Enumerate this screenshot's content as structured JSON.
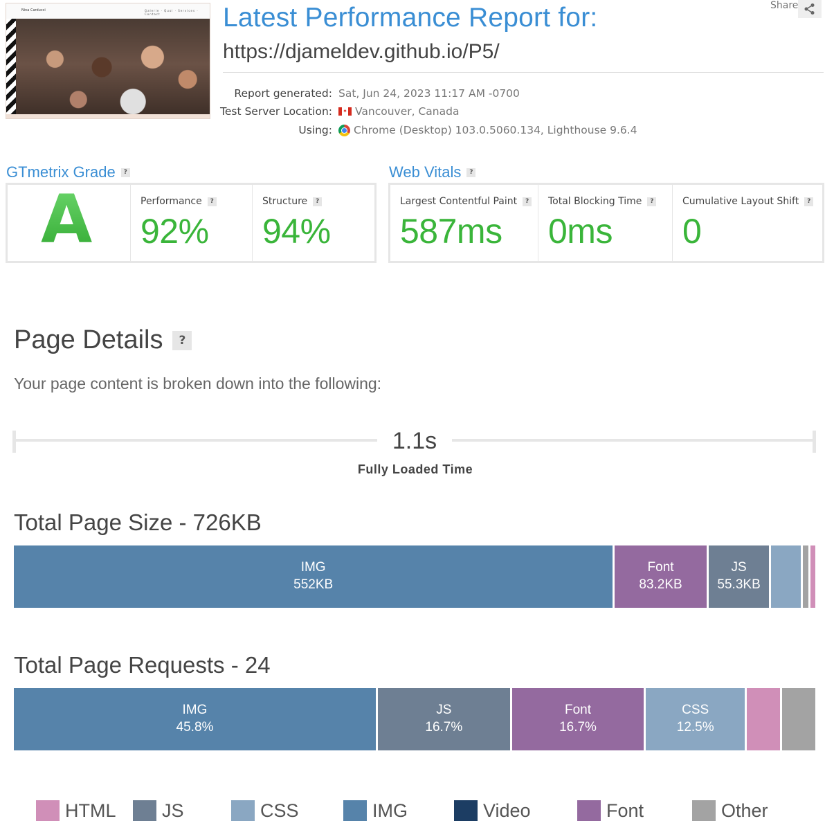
{
  "header": {
    "thumb_brand": "Nina Carducci",
    "thumb_nav": "Galerie · Quoi · Services · Contact",
    "title": "Latest Performance Report for:",
    "url": "https://djameldev.github.io/P5/",
    "share_label": "Share",
    "meta": {
      "report_generated_label": "Report generated:",
      "report_generated_value": "Sat, Jun 24, 2023 11:17 AM -0700",
      "location_label": "Test Server Location:",
      "location_value": "Vancouver, Canada",
      "using_label": "Using:",
      "using_value": "Chrome (Desktop) 103.0.5060.134, Lighthouse 9.6.4"
    }
  },
  "grade": {
    "heading": "GTmetrix Grade",
    "letter": "A",
    "performance_label": "Performance",
    "performance_value": "92%",
    "structure_label": "Structure",
    "structure_value": "94%"
  },
  "vitals": {
    "heading": "Web Vitals",
    "lcp_label": "Largest Contentful Paint",
    "lcp_value": "587ms",
    "tbt_label": "Total Blocking Time",
    "tbt_value": "0ms",
    "cls_label": "Cumulative Layout Shift",
    "cls_value": "0"
  },
  "page_details": {
    "title": "Page Details",
    "subtitle": "Your page content is broken down into the following:",
    "fully_loaded_value": "1.1s",
    "fully_loaded_label": "Fully Loaded Time"
  },
  "qmark": "?",
  "size_bar": {
    "title": "Total Page Size - 726KB",
    "segments": [
      {
        "type": "IMG",
        "value": "552KB",
        "share": 75.1
      },
      {
        "type": "Font",
        "value": "83.2KB",
        "share": 11.5
      },
      {
        "type": "JS",
        "value": "55.3KB",
        "share": 7.6
      },
      {
        "type": "CSS",
        "value": "",
        "share": 3.7
      },
      {
        "type": "Other",
        "value": "",
        "share": 0.7
      },
      {
        "type": "HTML",
        "value": "",
        "share": 0.6
      }
    ]
  },
  "requests_bar": {
    "title": "Total Page Requests - 24",
    "segments": [
      {
        "type": "IMG",
        "value": "45.8%",
        "share": 45.8
      },
      {
        "type": "JS",
        "value": "16.7%",
        "share": 16.7
      },
      {
        "type": "Font",
        "value": "16.7%",
        "share": 16.7
      },
      {
        "type": "CSS",
        "value": "12.5%",
        "share": 12.5
      },
      {
        "type": "HTML",
        "value": "",
        "share": 4.2
      },
      {
        "type": "Other",
        "value": "",
        "share": 4.2
      }
    ]
  },
  "legend": [
    {
      "label": "HTML",
      "color": "#d08fb8"
    },
    {
      "label": "JS",
      "color": "#6e7f93"
    },
    {
      "label": "CSS",
      "color": "#8aa7c2"
    },
    {
      "label": "IMG",
      "color": "#5683aa"
    },
    {
      "label": "Video",
      "color": "#1c3d63"
    },
    {
      "label": "Font",
      "color": "#946a9f"
    },
    {
      "label": "Other",
      "color": "#a3a3a3"
    }
  ]
}
